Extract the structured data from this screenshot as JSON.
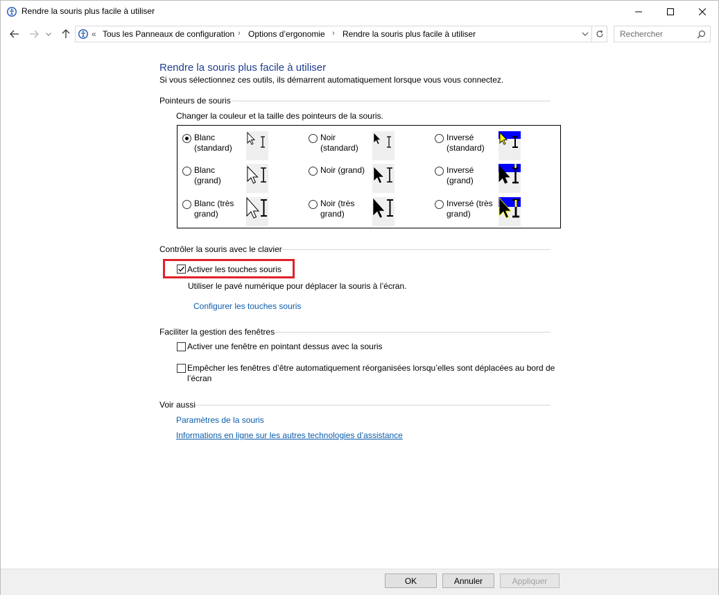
{
  "window": {
    "title": "Rendre la souris plus facile à utiliser"
  },
  "address": {
    "overflow": "«",
    "crumbs": [
      "Tous les Panneaux de configuration",
      "Options d’ergonomie",
      "Rendre la souris plus facile à utiliser"
    ],
    "search_placeholder": "Rechercher"
  },
  "page": {
    "title": "Rendre la souris plus facile à utiliser",
    "subtitle": "Si vous sélectionnez ces outils, ils démarrent automatiquement lorsque vous vous connectez."
  },
  "pointers": {
    "heading": "Pointeurs de souris",
    "description": "Changer la couleur et la taille des pointeurs de la souris.",
    "options": [
      {
        "label": "Blanc (standard)",
        "selected": true
      },
      {
        "label": "Noir (standard)",
        "selected": false
      },
      {
        "label": "Inversé (standard)",
        "selected": false
      },
      {
        "label": "Blanc (grand)",
        "selected": false
      },
      {
        "label": "Noir (grand)",
        "selected": false
      },
      {
        "label": "Inversé (grand)",
        "selected": false
      },
      {
        "label": "Blanc (très grand)",
        "selected": false
      },
      {
        "label": "Noir (très grand)",
        "selected": false
      },
      {
        "label": "Inversé (très grand)",
        "selected": false
      }
    ]
  },
  "keyboard": {
    "heading": "Contrôler la souris avec le clavier",
    "mousekeys_label": "Activer les touches souris",
    "mousekeys_checked": true,
    "mousekeys_desc": "Utiliser le pavé numérique pour déplacer la souris à l’écran.",
    "configure_link": "Configurer les touches souris"
  },
  "windows": {
    "heading": "Faciliter la gestion des fenêtres",
    "hover_label": "Activer une fenêtre en pointant dessus avec la souris",
    "hover_checked": false,
    "snap_label_line1": "Empêcher les fenêtres d’être automatiquement réorganisées lorsqu’elles sont déplacées au bord de",
    "snap_label_line2": "l’écran",
    "snap_checked": false
  },
  "see_also": {
    "heading": "Voir aussi",
    "link1": "Paramètres de la souris",
    "link2": "Informations en ligne sur les autres technologies d’assistance"
  },
  "footer": {
    "ok": "OK",
    "cancel": "Annuler",
    "apply": "Appliquer"
  },
  "colors": {
    "title_blue": "#1e3d8f",
    "link_blue": "#0b5cab",
    "highlight_red": "#e0202a",
    "inverse_blue": "#0000ff",
    "inverse_yellow": "#ffff00"
  }
}
